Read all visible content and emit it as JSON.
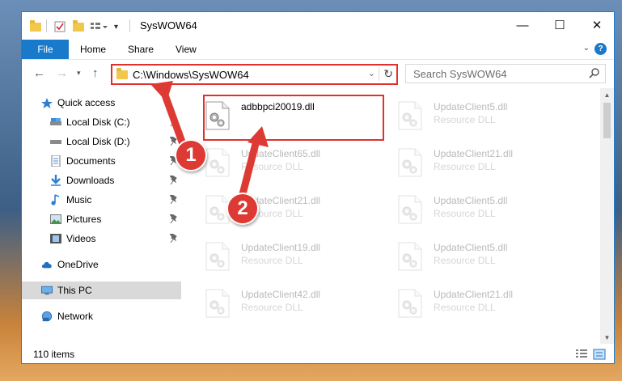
{
  "window": {
    "title": "SysWOW64",
    "controls": {
      "minimize": "—",
      "maximize": "☐",
      "close": "✕"
    }
  },
  "ribbon": {
    "tabs": [
      "File",
      "Home",
      "Share",
      "View"
    ],
    "help": "?"
  },
  "nav": {
    "address": "C:\\Windows\\SysWOW64",
    "search_placeholder": "Search SysWOW64"
  },
  "sidebar": {
    "items": [
      {
        "label": "Quick access",
        "icon": "star-icon"
      },
      {
        "label": "Local Disk (C:)",
        "icon": "drive-icon",
        "pinned": true
      },
      {
        "label": "Local Disk (D:)",
        "icon": "drive-icon",
        "pinned": true
      },
      {
        "label": "Documents",
        "icon": "documents-icon",
        "pinned": true
      },
      {
        "label": "Downloads",
        "icon": "downloads-icon",
        "pinned": true
      },
      {
        "label": "Music",
        "icon": "music-icon",
        "pinned": true
      },
      {
        "label": "Pictures",
        "icon": "pictures-icon",
        "pinned": true
      },
      {
        "label": "Videos",
        "icon": "videos-icon",
        "pinned": true
      },
      {
        "label": "OneDrive",
        "icon": "cloud-icon"
      },
      {
        "label": "This PC",
        "icon": "computer-icon",
        "selected": true
      },
      {
        "label": "Network",
        "icon": "network-icon"
      }
    ]
  },
  "files": [
    {
      "name": "adbbpci20019.dll",
      "type": ""
    },
    {
      "name": "UpdateClient5.dll",
      "type": "Resource DLL"
    },
    {
      "name": "UpdateClient65.dll",
      "type": "Resource DLL"
    },
    {
      "name": "UpdateClient21.dll",
      "type": "Resource DLL"
    },
    {
      "name": "UpdateClient21.dll",
      "type": "Resource DLL"
    },
    {
      "name": "UpdateClient5.dll",
      "type": "Resource DLL"
    },
    {
      "name": "UpdateClient19.dll",
      "type": "Resource DLL"
    },
    {
      "name": "UpdateClient5.dll",
      "type": "Resource DLL"
    },
    {
      "name": "UpdateClient42.dll",
      "type": "Resource DLL"
    },
    {
      "name": "UpdateClient21.dll",
      "type": "Resource DLL"
    }
  ],
  "status": {
    "item_count": "110 items"
  },
  "annotations": {
    "step1": "1",
    "step2": "2"
  },
  "colors": {
    "accent": "#1979ca",
    "highlight": "#e0312d",
    "badge": "#dd3a34"
  }
}
